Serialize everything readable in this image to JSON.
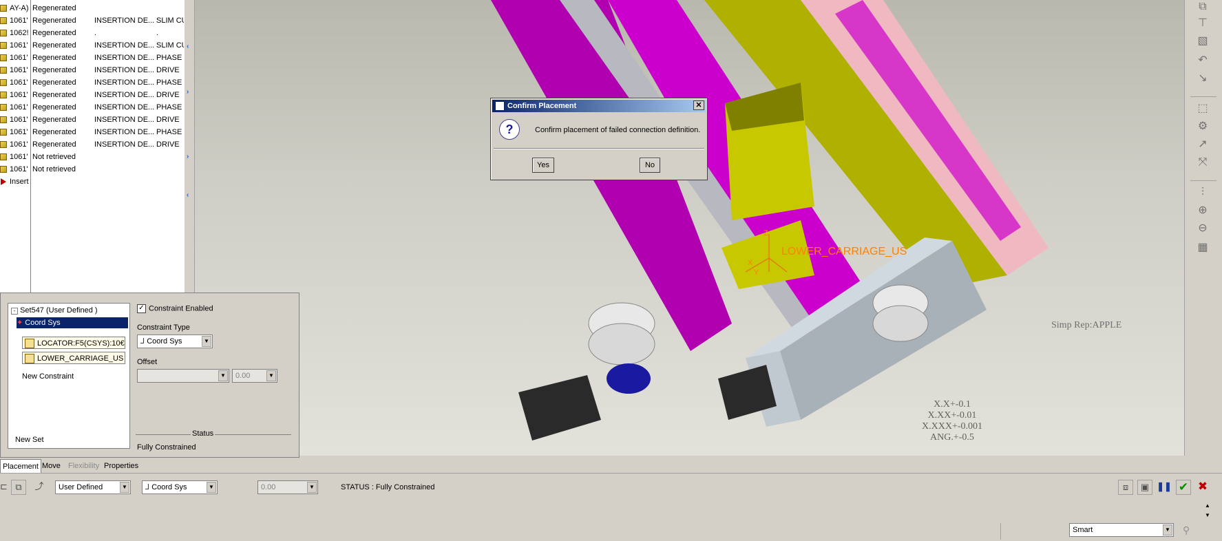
{
  "tree": {
    "rows": [
      {
        "name": "AY-A)",
        "status": "Regenerated",
        "c3": "",
        "c4": ""
      },
      {
        "name": "1061'",
        "status": "Regenerated",
        "c3": "INSERTION DE...",
        "c4": "SLIM CU"
      },
      {
        "name": "1062!",
        "status": "Regenerated",
        "c3": ".",
        "c4": "."
      },
      {
        "name": "1061'",
        "status": "Regenerated",
        "c3": "INSERTION DE...",
        "c4": "SLIM CU"
      },
      {
        "name": "1061'",
        "status": "Regenerated",
        "c3": "INSERTION DE...",
        "c4": "PHASE"
      },
      {
        "name": "1061'",
        "status": "Regenerated",
        "c3": "INSERTION DE...",
        "c4": "DRIVE"
      },
      {
        "name": "1061'",
        "status": "Regenerated",
        "c3": "INSERTION DE...",
        "c4": "PHASE"
      },
      {
        "name": "1061'",
        "status": "Regenerated",
        "c3": "INSERTION DE...",
        "c4": "DRIVE"
      },
      {
        "name": "1061'",
        "status": "Regenerated",
        "c3": "INSERTION DE...",
        "c4": "PHASE"
      },
      {
        "name": "1061'",
        "status": "Regenerated",
        "c3": "INSERTION DE...",
        "c4": "DRIVE"
      },
      {
        "name": "1061'",
        "status": "Regenerated",
        "c3": "INSERTION DE...",
        "c4": "PHASE"
      },
      {
        "name": "1061'",
        "status": "Regenerated",
        "c3": "INSERTION DE...",
        "c4": "DRIVE"
      },
      {
        "name": "1061'",
        "status": "Not retrieved",
        "c3": "",
        "c4": ""
      },
      {
        "name": "1061'",
        "status": "Not retrieved",
        "c3": "",
        "c4": ""
      }
    ],
    "insert_label": "Insert"
  },
  "dialog": {
    "title": "Confirm Placement",
    "message": "Confirm placement of failed connection definition.",
    "yes": "Yes",
    "no": "No"
  },
  "panel": {
    "set_name": "Set547 (User Defined )",
    "constraint": "Coord Sys",
    "ref1": "LOCATOR:F5(CSYS):10€",
    "ref2": "LOWER_CARRIAGE_US",
    "new_constraint": "New Constraint",
    "new_set": "New Set",
    "constraint_enabled": "Constraint Enabled",
    "constraint_type_label": "Constraint Type",
    "constraint_type_value": "Coord Sys",
    "offset_label": "Offset",
    "offset_value": "0.00",
    "status_label": "Status",
    "status_value": "Fully Constrained"
  },
  "tabs": [
    "Placement",
    "Move",
    "Flexibility",
    "Properties"
  ],
  "dashboard": {
    "set_type": "User Defined",
    "constraint": "Coord Sys",
    "offset": "0.00",
    "status": "STATUS : Fully Constrained"
  },
  "viewport": {
    "csys_label": "LOWER_CARRIAGE_US",
    "simp_rep": "Simp Rep:APPLE",
    "tolerances": [
      "X.X+-0.1",
      "X.XX+-0.01",
      "X.XXX+-0.001",
      "ANG.+-0.5"
    ],
    "axis_x": "X",
    "axis_y": "Y",
    "axis_z": "Z"
  },
  "statusbar": {
    "filter": "Smart"
  },
  "colors": {
    "magenta": "#cc00cc",
    "yellow": "#c8c800",
    "olive": "#808000",
    "pink": "#f0b8c0",
    "grey": "#a8b0b8"
  }
}
